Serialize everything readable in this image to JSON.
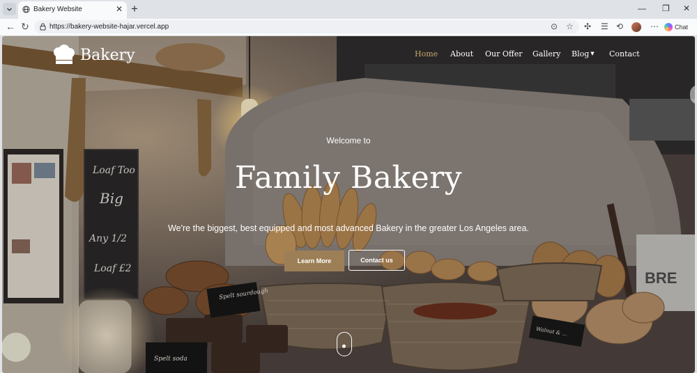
{
  "browser": {
    "tab_title": "Bakery Website",
    "url": "https://bakery-website-hajar.vercel.app",
    "chat_label": "Chat"
  },
  "site": {
    "logo_text": "Bakery",
    "nav": [
      {
        "label": "Home",
        "active": true
      },
      {
        "label": "About"
      },
      {
        "label": "Our Offer"
      },
      {
        "label": "Gallery"
      },
      {
        "label": "Blog",
        "has_dropdown": true
      },
      {
        "label": "Contact"
      }
    ],
    "hero": {
      "welcome": "Welcome to",
      "title": "Family Bakery",
      "subtitle": "We're the biggest, best equipped and most advanced Bakery in the greater Los Angeles area.",
      "primary_button": "Learn More",
      "secondary_button": "Contact us"
    },
    "chalkboard_text": [
      "Loaf Too",
      "Big",
      "Any 1/2",
      "Loaf £2"
    ],
    "sign_texts": [
      "Spelt sourdough",
      "Spelt soda",
      "Walnut & ..."
    ],
    "bin_text": "BRE",
    "colors": {
      "accent": "#9d7f57",
      "active_nav": "#c8a96e"
    }
  }
}
